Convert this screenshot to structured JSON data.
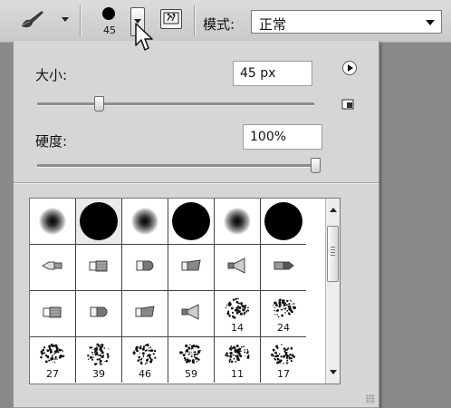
{
  "toolbar": {
    "brush_tool_icon": "brush-icon",
    "brush_size_label": "45",
    "panel_toggle_icon": "brush-panel-icon",
    "mode_label": "模式:",
    "mode_value": "正常"
  },
  "brush_picker": {
    "size_label": "大小:",
    "size_value": "45 px",
    "size_fraction": 0.22,
    "hardness_label": "硬度:",
    "hardness_value": "100%",
    "hardness_fraction": 1.0,
    "flyout_menu_icon": "play-circle-icon",
    "new_preset_icon": "new-preset-icon",
    "presets": [
      {
        "kind": "soft-round",
        "label": ""
      },
      {
        "kind": "hard-round",
        "label": ""
      },
      {
        "kind": "soft-round",
        "label": ""
      },
      {
        "kind": "hard-round",
        "label": ""
      },
      {
        "kind": "soft-round",
        "label": ""
      },
      {
        "kind": "hard-round",
        "label": ""
      },
      {
        "kind": "airbrush-tip",
        "label": ""
      },
      {
        "kind": "chisel-flat",
        "label": ""
      },
      {
        "kind": "round-blunt",
        "label": ""
      },
      {
        "kind": "chisel-angled",
        "label": ""
      },
      {
        "kind": "fan-brush",
        "label": ""
      },
      {
        "kind": "round-point",
        "label": ""
      },
      {
        "kind": "chisel-flat",
        "label": ""
      },
      {
        "kind": "round-blunt",
        "label": ""
      },
      {
        "kind": "chisel-angled",
        "label": ""
      },
      {
        "kind": "fan-brush",
        "label": ""
      },
      {
        "kind": "scatter",
        "label": "14"
      },
      {
        "kind": "scatter",
        "label": "24"
      },
      {
        "kind": "scatter",
        "label": "27"
      },
      {
        "kind": "scatter",
        "label": "39"
      },
      {
        "kind": "scatter",
        "label": "46"
      },
      {
        "kind": "scatter",
        "label": "59"
      },
      {
        "kind": "scatter",
        "label": "11"
      },
      {
        "kind": "scatter",
        "label": "17"
      }
    ]
  }
}
